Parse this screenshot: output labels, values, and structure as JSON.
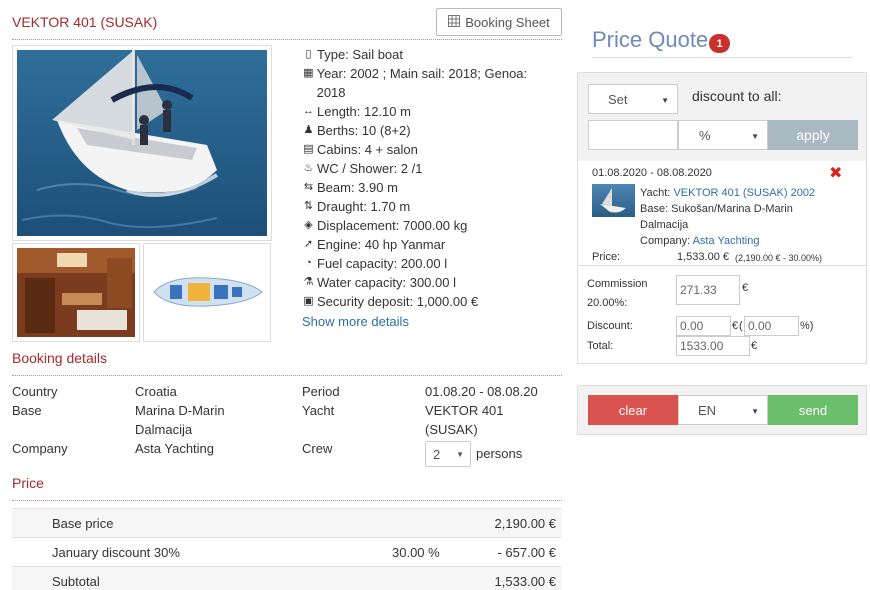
{
  "yacht": {
    "title": "VEKTOR 401 (SUSAK)",
    "booking_sheet_label": "Booking Sheet"
  },
  "specs": [
    {
      "icon": "building-icon",
      "text": "Type: Sail boat"
    },
    {
      "icon": "calendar-icon",
      "text": "Year: 2002 ; Main sail: 2018; Genoa: 2018"
    },
    {
      "icon": "arrows-horizontal-icon",
      "text": "Length: 12.10 m"
    },
    {
      "icon": "person-icon",
      "text": "Berths: 10 (8+2)"
    },
    {
      "icon": "door-icon",
      "text": "Cabins: 4 + salon"
    },
    {
      "icon": "shower-icon",
      "text": "WC / Shower: 2 /1"
    },
    {
      "icon": "beam-icon",
      "text": "Beam: 3.90 m"
    },
    {
      "icon": "draught-icon",
      "text": "Draught: 1.70 m"
    },
    {
      "icon": "cube-icon",
      "text": "Displacement: 7000.00 kg"
    },
    {
      "icon": "rocket-icon",
      "text": "Engine: 40 hp Yanmar"
    },
    {
      "icon": "fuel-icon",
      "text": "Fuel capacity: 200.00 l"
    },
    {
      "icon": "flask-icon",
      "text": "Water capacity: 300.00 l"
    },
    {
      "icon": "briefcase-icon",
      "text": "Security deposit: 1,000.00 €"
    }
  ],
  "show_more_label": "Show more details",
  "booking_details": {
    "title": "Booking details",
    "country_label": "Country",
    "country_value": "Croatia",
    "base_label": "Base",
    "base_value_1": "Marina D-Marin",
    "base_value_2": "Dalmacija",
    "company_label": "Company",
    "company_value": "Asta Yachting",
    "period_label": "Period",
    "period_value": "01.08.20 - 08.08.20",
    "yacht_label": "Yacht",
    "yacht_value_1": "VEKTOR 401",
    "yacht_value_2": "(SUSAK)",
    "crew_label": "Crew",
    "crew_value": "2",
    "crew_unit": "persons"
  },
  "price": {
    "title": "Price",
    "rows": [
      {
        "label": "Base price",
        "percent": "",
        "value": "2,190.00 €"
      },
      {
        "label": "January discount 30%",
        "percent": "30.00 %",
        "value": "- 657.00 €"
      },
      {
        "label": "Subtotal",
        "percent": "",
        "value": "1,533.00 €"
      }
    ]
  },
  "quote": {
    "title": "Price Quote",
    "badge": "1",
    "set_select": "Set",
    "discount_to_all": "discount to all:",
    "discount_value": "",
    "percent_select": "%",
    "apply_label": "apply",
    "item": {
      "dates": "01.08.2020 - 08.08.2020",
      "yacht_prefix": "Yacht:",
      "yacht_link": "VEKTOR 401 (SUSAK) 2002",
      "base_line_1": "Base: Sukošan/Marina D-Marin",
      "base_line_2": "Dalmacija",
      "company_prefix": "Company:",
      "company_link": "Asta Yachting",
      "price_label": "Price:",
      "price_value": "1,533.00 €",
      "price_detail": "(2,190.00 € - 30.00%)"
    },
    "commission_label_1": "Commission",
    "commission_label_2": "20.00%:",
    "commission_value": "271.33",
    "discount_label": "Discount:",
    "discount_amount": "0.00",
    "discount_percent": "0.00",
    "total_label": "Total:",
    "total_value": "1533.00",
    "euro": "€",
    "paren_open": "(",
    "paren_close": "%)",
    "clear_label": "clear",
    "language": "EN",
    "send_label": "send"
  },
  "colors": {
    "accent_red": "#a52a2a",
    "link_blue": "#2c6fa8",
    "quote_title": "#6f8ab8",
    "clear_red": "#d9534f",
    "send_green": "#6bbf6b"
  }
}
